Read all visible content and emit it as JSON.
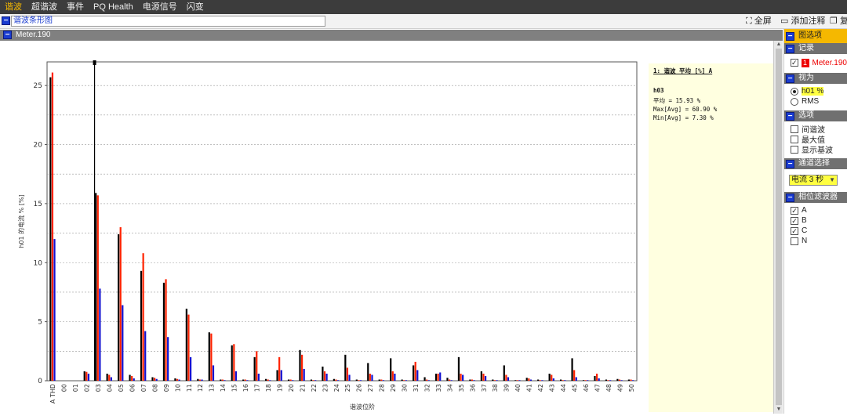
{
  "menu": {
    "items": [
      "谐波",
      "超谐波",
      "事件",
      "PQ Health",
      "电源信号",
      "闪变"
    ],
    "active_index": 0
  },
  "toolbar": {
    "title_value": "谐波条形图",
    "fullscreen_label": "全屏",
    "annotate_label": "添加注释",
    "copy_label": "复"
  },
  "panel": {
    "title": "Meter.190"
  },
  "info": {
    "header": "1: 谐波 平均 [%] A",
    "harmonic": "h03",
    "avg": "平均 = 15.93 %",
    "max": "Max[Avg] = 60.90 %",
    "min": "Min[Avg] = 7.30 %"
  },
  "sidebar": {
    "title": "图选项",
    "records": {
      "title": "记录",
      "badge": "1",
      "item": "Meter.190",
      "checked": true
    },
    "view": {
      "title": "视为",
      "options": [
        "h01 %",
        "RMS"
      ],
      "selected": 0
    },
    "options": {
      "title": "选项",
      "items": [
        "间谐波",
        "最大值",
        "显示基波"
      ]
    },
    "channel": {
      "title": "通道选择",
      "selected": "电流 3 秒"
    },
    "phase_filter": {
      "title": "相位滤波器",
      "items": [
        {
          "label": "A",
          "checked": true
        },
        {
          "label": "B",
          "checked": true
        },
        {
          "label": "C",
          "checked": true
        },
        {
          "label": "N",
          "checked": false
        }
      ]
    }
  },
  "colors": {
    "phase_a": "#000000",
    "phase_b": "#ff2200",
    "phase_c": "#1010d0"
  },
  "chart_data": {
    "type": "bar",
    "xlabel": "谐波位阶",
    "ylabel": "h01 的电流 % [%]",
    "ylim": [
      0,
      27
    ],
    "yticks": [
      0,
      5,
      10,
      15,
      20,
      25
    ],
    "grid": true,
    "cursor_category": "03",
    "categories": [
      "A THD",
      "00",
      "01",
      "02",
      "03",
      "04",
      "05",
      "06",
      "07",
      "08",
      "09",
      "10",
      "11",
      "12",
      "13",
      "14",
      "15",
      "16",
      "17",
      "18",
      "19",
      "20",
      "21",
      "22",
      "23",
      "24",
      "25",
      "26",
      "27",
      "28",
      "29",
      "30",
      "31",
      "32",
      "33",
      "34",
      "35",
      "36",
      "37",
      "38",
      "39",
      "40",
      "41",
      "42",
      "43",
      "44",
      "45",
      "46",
      "47",
      "48",
      "49",
      "50"
    ],
    "series": [
      {
        "values": [
          25.7,
          0,
          0,
          0.8,
          15.9,
          0.6,
          12.4,
          0.5,
          9.3,
          0.3,
          8.3,
          0.2,
          6.1,
          0.15,
          4.1,
          0.1,
          3.0,
          0.1,
          2.0,
          0.15,
          0.9,
          0.1,
          2.6,
          0.1,
          1.2,
          0.15,
          2.2,
          0.1,
          1.5,
          0.1,
          1.9,
          0.1,
          1.3,
          0.3,
          0.6,
          0.25,
          2.0,
          0.1,
          0.8,
          0.1,
          1.3,
          0.05,
          0.25,
          0.1,
          0.6,
          0.1,
          1.9,
          0.05,
          0.4,
          0.1,
          0.15,
          0.1
        ]
      },
      {
        "values": [
          26.1,
          0,
          0,
          0.75,
          15.7,
          0.5,
          13.0,
          0.4,
          10.8,
          0.25,
          8.6,
          0.15,
          5.6,
          0.1,
          4.0,
          0.1,
          3.1,
          0.1,
          2.5,
          0.1,
          2.0,
          0.1,
          2.2,
          0.05,
          0.8,
          0.1,
          1.1,
          0.05,
          0.6,
          0.1,
          0.8,
          0.05,
          1.6,
          0.1,
          0.6,
          0.1,
          0.6,
          0.1,
          0.6,
          0.05,
          0.5,
          0.05,
          0.2,
          0.05,
          0.5,
          0.05,
          0.9,
          0.05,
          0.6,
          0.05,
          0.1,
          0.1
        ]
      },
      {
        "values": [
          12.0,
          0,
          0,
          0.6,
          7.8,
          0.3,
          6.4,
          0.2,
          4.2,
          0.15,
          3.7,
          0.1,
          2.0,
          0.1,
          1.3,
          0.05,
          0.8,
          0.05,
          0.6,
          0.05,
          0.9,
          0.05,
          1.0,
          0.05,
          0.6,
          0.05,
          0.5,
          0.05,
          0.5,
          0.05,
          0.6,
          0.05,
          0.9,
          0.05,
          0.7,
          0.05,
          0.5,
          0.05,
          0.4,
          0.05,
          0.3,
          0.05,
          0.1,
          0.05,
          0.2,
          0.05,
          0.3,
          0.05,
          0.2,
          0.05,
          0.05,
          0.05
        ]
      }
    ]
  }
}
